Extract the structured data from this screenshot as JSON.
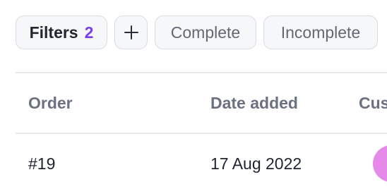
{
  "filters": {
    "label": "Filters",
    "count": "2",
    "add_icon": "plus-icon",
    "chips": [
      "Complete",
      "Incomplete"
    ]
  },
  "table": {
    "columns": [
      "Order",
      "Date added",
      "Cus"
    ],
    "rows": [
      {
        "order": "#19",
        "date_added": "17 Aug 2022",
        "customer_avatar": ""
      }
    ]
  },
  "colors": {
    "accent": "#7a3df0",
    "avatar": "#e58ae8",
    "chip_bg": "#f6f7f9",
    "chip_border": "#d9dce2",
    "divider": "#e6e8ec"
  }
}
